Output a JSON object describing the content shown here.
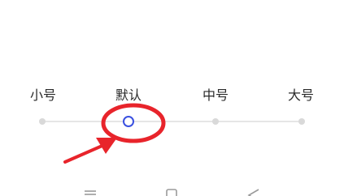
{
  "font_size": {
    "options": [
      {
        "label": "小号",
        "selected": false
      },
      {
        "label": "默认",
        "selected": true
      },
      {
        "label": "中号",
        "selected": false
      },
      {
        "label": "大号",
        "selected": false
      }
    ],
    "selected_index": 1
  },
  "annotation": {
    "shape": "circle-and-arrow",
    "color": "#e8242b"
  },
  "colors": {
    "track": "#e6e6e6",
    "tick": "#d9d9d9",
    "thumb": "#3a50e0",
    "text": "#2a2a2a"
  },
  "navigation": {
    "icons": [
      "menu-icon",
      "home-icon",
      "back-icon"
    ]
  }
}
